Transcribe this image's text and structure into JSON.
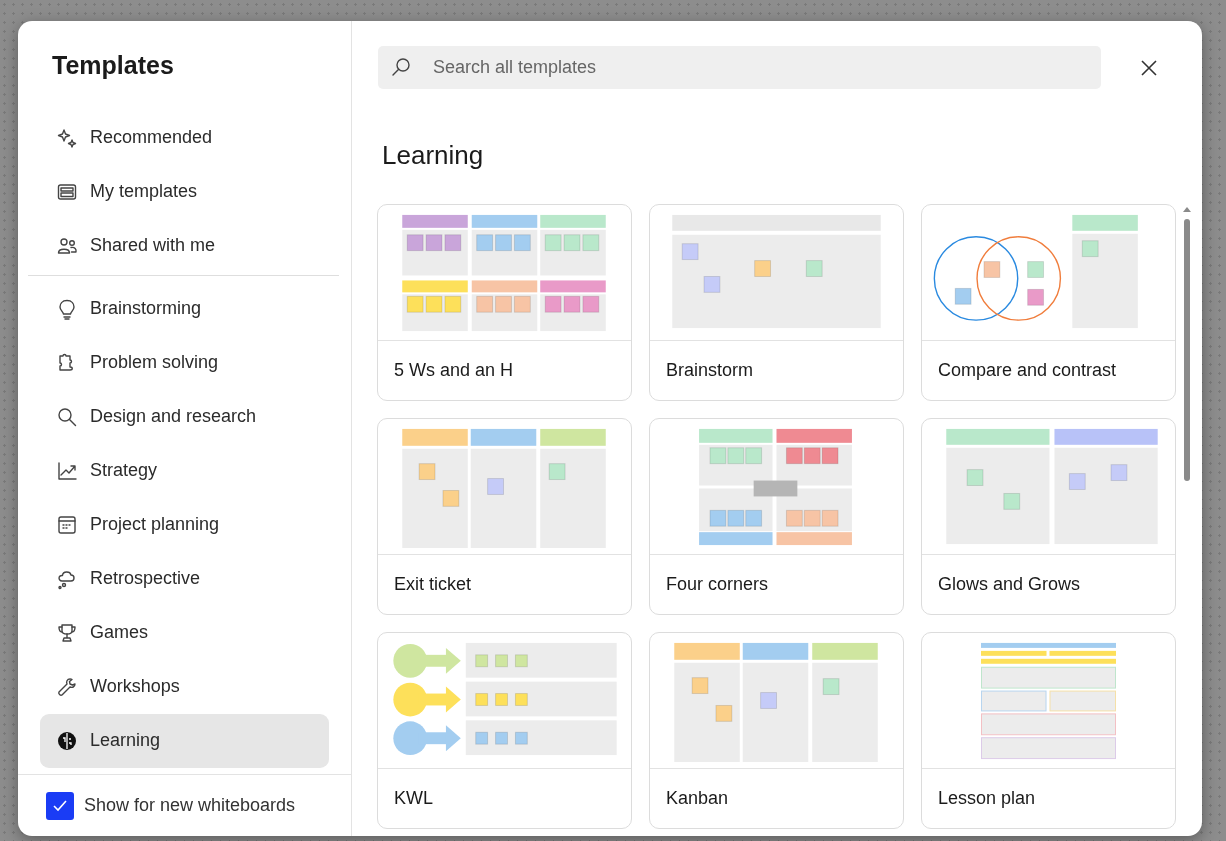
{
  "sidebar": {
    "title": "Templates",
    "groups": [
      {
        "items": [
          {
            "label": "Recommended",
            "selected": false
          },
          {
            "label": "My templates",
            "selected": false
          },
          {
            "label": "Shared with me",
            "selected": false
          }
        ]
      },
      {
        "items": [
          {
            "label": "Brainstorming",
            "selected": false
          },
          {
            "label": "Problem solving",
            "selected": false
          },
          {
            "label": "Design and research",
            "selected": false
          },
          {
            "label": "Strategy",
            "selected": false
          },
          {
            "label": "Project planning",
            "selected": false
          },
          {
            "label": "Retrospective",
            "selected": false
          },
          {
            "label": "Games",
            "selected": false
          },
          {
            "label": "Workshops",
            "selected": false
          },
          {
            "label": "Learning",
            "selected": true
          }
        ]
      }
    ],
    "footer_checkbox": {
      "label": "Show for new whiteboards",
      "checked": true
    }
  },
  "search": {
    "placeholder": "Search all templates"
  },
  "section": {
    "title": "Learning"
  },
  "templates": [
    {
      "title": "5 Ws and an H",
      "kind": "fivews"
    },
    {
      "title": "Brainstorm",
      "kind": "brainstorm"
    },
    {
      "title": "Compare and contrast",
      "kind": "venn"
    },
    {
      "title": "Exit ticket",
      "kind": "exit"
    },
    {
      "title": "Four corners",
      "kind": "fourcorners"
    },
    {
      "title": "Glows and Grows",
      "kind": "glows"
    },
    {
      "title": "KWL",
      "kind": "kwl"
    },
    {
      "title": "Kanban",
      "kind": "kanban"
    },
    {
      "title": "Lesson plan",
      "kind": "lesson"
    }
  ]
}
